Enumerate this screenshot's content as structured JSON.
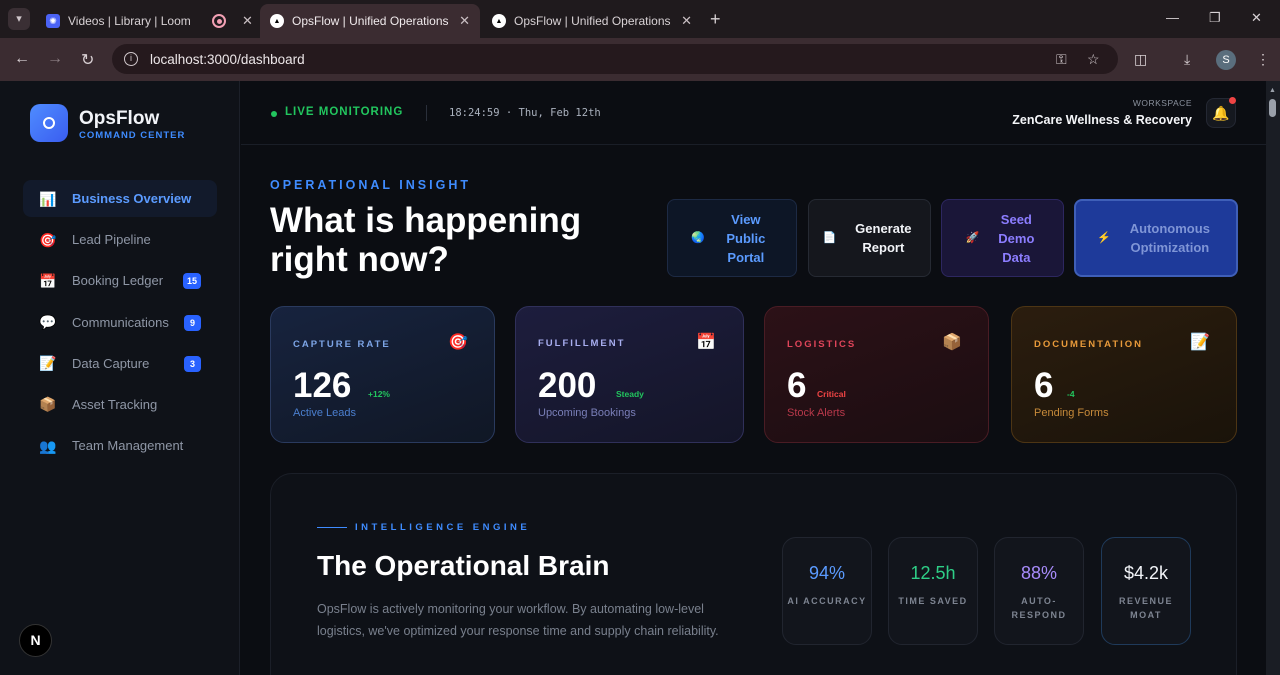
{
  "browser": {
    "tabs": [
      {
        "title": "Videos | Library | Loom",
        "icon": "loom-icon"
      },
      {
        "title": "",
        "icon": "record-icon"
      },
      {
        "title": "OpsFlow | Unified Operations P",
        "icon": "vercel-icon",
        "active": true
      },
      {
        "title": "OpsFlow | Unified Operations P",
        "icon": "vercel-icon"
      }
    ],
    "url": "localhost:3000/dashboard",
    "profile_initial": "S"
  },
  "sidebar": {
    "brand": "OpsFlow",
    "brand_sub": "COMMAND CENTER",
    "items": [
      {
        "label": "Business Overview",
        "icon": "bar-chart-icon",
        "active": true,
        "badge": ""
      },
      {
        "label": "Lead Pipeline",
        "icon": "target-icon",
        "badge": ""
      },
      {
        "label": "Booking Ledger",
        "icon": "calendar-icon",
        "badge": "15"
      },
      {
        "label": "Communications",
        "icon": "speech-bubble-icon",
        "badge": "9"
      },
      {
        "label": "Data Capture",
        "icon": "memo-icon",
        "badge": "3"
      },
      {
        "label": "Asset Tracking",
        "icon": "package-icon",
        "badge": ""
      },
      {
        "label": "Team Management",
        "icon": "people-icon",
        "badge": ""
      }
    ],
    "nextjs_badge": "N"
  },
  "header": {
    "live": "LIVE MONITORING",
    "clock": "18:24:59 · Thu, Feb 12th",
    "workspace_label": "WORKSPACE",
    "workspace_name": "ZenCare Wellness & Recovery"
  },
  "hero": {
    "eyebrow": "OPERATIONAL INSIGHT",
    "title": "What is happening right now?"
  },
  "actions": [
    {
      "label": "View Public Portal",
      "icon": "globe-icon"
    },
    {
      "label": "Generate Report",
      "icon": "document-icon"
    },
    {
      "label": "Seed Demo Data",
      "icon": "rocket-icon"
    },
    {
      "label": "Autonomous Optimization",
      "icon": "bolt-icon"
    }
  ],
  "stats": [
    {
      "key": "CAPTURE RATE",
      "value": "126",
      "delta": "+12%",
      "sub": "Active Leads",
      "icon": "target-icon",
      "delta_color": "#22c55e",
      "sub_color": "#4b7fcf"
    },
    {
      "key": "FULFILLMENT",
      "value": "200",
      "delta": "Steady",
      "sub": "Upcoming Bookings",
      "icon": "calendar-icon",
      "delta_color": "#22c55e",
      "sub_color": "#7a7fb8"
    },
    {
      "key": "LOGISTICS",
      "value": "6",
      "delta": "Critical",
      "sub": "Stock Alerts",
      "icon": "package-icon",
      "delta_color": "#ef4444",
      "sub_color": "#b8384a"
    },
    {
      "key": "DOCUMENTATION",
      "value": "6",
      "delta": "-4",
      "sub": "Pending Forms",
      "icon": "memo-icon",
      "delta_color": "#22c55e",
      "sub_color": "#c78a3a"
    }
  ],
  "brain": {
    "eyebrow": "INTELLIGENCE ENGINE",
    "title": "The Operational Brain",
    "body": "OpsFlow is actively monitoring your workflow. By automating low-level logistics, we've optimized your response time and supply chain reliability.",
    "metrics": [
      {
        "value": "94%",
        "label": "AI ACCURACY",
        "color": "#5b9bff"
      },
      {
        "value": "12.5h",
        "label": "TIME SAVED",
        "color": "#2ecf87"
      },
      {
        "value": "88%",
        "label": "AUTO-RESPOND",
        "color": "#a78bfa"
      },
      {
        "value": "$4.2k",
        "label": "REVENUE MOAT",
        "color": "#f2f4f8"
      }
    ]
  }
}
